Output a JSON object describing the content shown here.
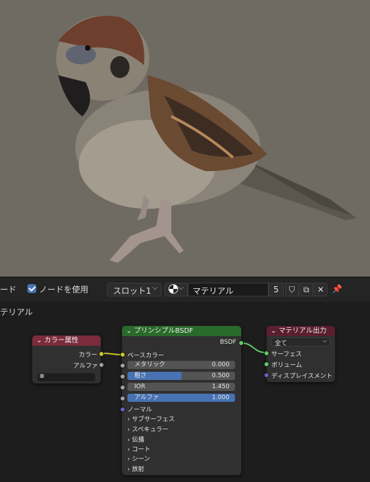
{
  "header": {
    "editor_label": "ード",
    "use_nodes_label": "ノードを使用",
    "slot_label": "スロット1",
    "material_name": "マテリアル",
    "user_count": "5",
    "pin_icon": "pin-icon"
  },
  "breadcrumb": "テリアル",
  "nodes": {
    "color_attribute": {
      "title": "カラー属性",
      "outputs": [
        "カラー",
        "アルファ"
      ],
      "color": "#7a2c3c"
    },
    "principled": {
      "title": "プリンシプルBSDF",
      "output": "BSDF",
      "base_color": "ベースカラー",
      "fields": [
        {
          "label": "メタリック",
          "value": "0.000",
          "fill": 0.0
        },
        {
          "label": "粗さ",
          "value": "0.500",
          "fill": 0.5
        },
        {
          "label": "IOR",
          "value": "1.450",
          "fill": 0.0
        },
        {
          "label": "アルファ",
          "value": "1.000",
          "fill": 1.0
        }
      ],
      "normal": "ノーマル",
      "panels": [
        "サブサーフェス",
        "スペキュラー",
        "伝播",
        "コート",
        "シーン",
        "放射"
      ],
      "color": "#2a6a2a"
    },
    "material_output": {
      "title": "マテリアル出力",
      "target": "全て",
      "inputs": [
        "サーフェス",
        "ボリューム",
        "ディスプレイスメント"
      ],
      "color": "#5a1f30"
    }
  },
  "colors": {
    "accent": "#4772b3",
    "socket_color": "#c7c729",
    "socket_shader": "#63c763",
    "socket_grey": "#a1a1a1",
    "socket_vector": "#6363c7"
  }
}
